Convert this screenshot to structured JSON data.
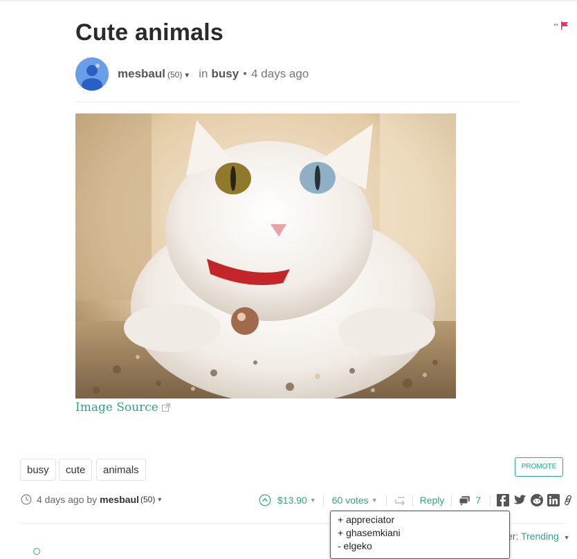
{
  "post": {
    "title": "Cute animals",
    "author": "mesbaul",
    "reputation": "(50)",
    "in_label": "in",
    "category": "busy",
    "time": "4 days ago",
    "image_source_label": "Image Source"
  },
  "tags": [
    "busy",
    "cute",
    "animals"
  ],
  "promote_label": "PROMOTE",
  "footer": {
    "time_prefix": "4 days ago by",
    "author": "mesbaul",
    "reputation": "(50)",
    "payout": "$13.90",
    "votes": "60 votes",
    "reply_label": "Reply",
    "comments_count": "7"
  },
  "voters_dropdown": {
    "items": [
      "+ appreciator",
      "+ ghasemkiani",
      "- elgeko"
    ]
  },
  "sort": {
    "label": "er:",
    "value": "Trending"
  },
  "colors": {
    "accent": "#2aa58a",
    "flag": "#e8336d",
    "avatar": "#6a9ee8"
  },
  "icons": [
    "flag-icon",
    "caret-down-icon",
    "external-link-icon",
    "clock-icon",
    "upvote-icon",
    "reblog-icon",
    "comments-icon",
    "facebook-icon",
    "twitter-icon",
    "reddit-icon",
    "linkedin-icon",
    "link-icon"
  ]
}
